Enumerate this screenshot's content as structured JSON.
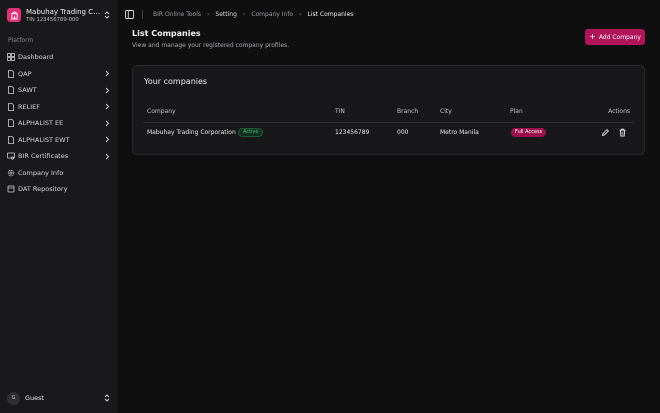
{
  "org": {
    "name": "Mabuhay Trading Corp...",
    "tin": "TIN 123456789-000"
  },
  "sidebar": {
    "section_label": "Platform",
    "items": [
      {
        "label": "Dashboard",
        "icon": "dashboard-icon",
        "has_chevron": false
      },
      {
        "label": "QAP",
        "icon": "document-icon",
        "has_chevron": true
      },
      {
        "label": "SAWT",
        "icon": "document-icon",
        "has_chevron": true
      },
      {
        "label": "RELIEF",
        "icon": "document-icon",
        "has_chevron": true
      },
      {
        "label": "ALPHALIST EE",
        "icon": "document-icon",
        "has_chevron": true
      },
      {
        "label": "ALPHALIST EWT",
        "icon": "document-icon",
        "has_chevron": true
      },
      {
        "label": "BIR Certificates",
        "icon": "certificate-icon",
        "has_chevron": true
      },
      {
        "label": "Company Info",
        "icon": "gear-icon",
        "has_chevron": false
      },
      {
        "label": "DAT Repository",
        "icon": "database-icon",
        "has_chevron": false
      }
    ]
  },
  "user": {
    "initial": "G",
    "name": "Guest"
  },
  "breadcrumb": [
    "BIR Online Tools",
    "Setting",
    "Company Info",
    "List Companies"
  ],
  "page": {
    "title": "List Companies",
    "subtitle": "View and manage your registered company profiles.",
    "add_button": "Add Company"
  },
  "card": {
    "title": "Your companies",
    "columns": [
      "Company",
      "TIN",
      "Branch",
      "City",
      "Plan",
      "Actions"
    ],
    "rows": [
      {
        "company": "Mabuhay Trading Corporation",
        "status": "Active",
        "tin": "123456789",
        "branch": "000",
        "city": "Metro Manila",
        "plan": "Full Access"
      }
    ]
  },
  "colors": {
    "accent": "#b0155a",
    "logo": "#e0307a",
    "active": "#4ac27a",
    "background": "#0f0f10",
    "sidebar": "#19191b"
  }
}
